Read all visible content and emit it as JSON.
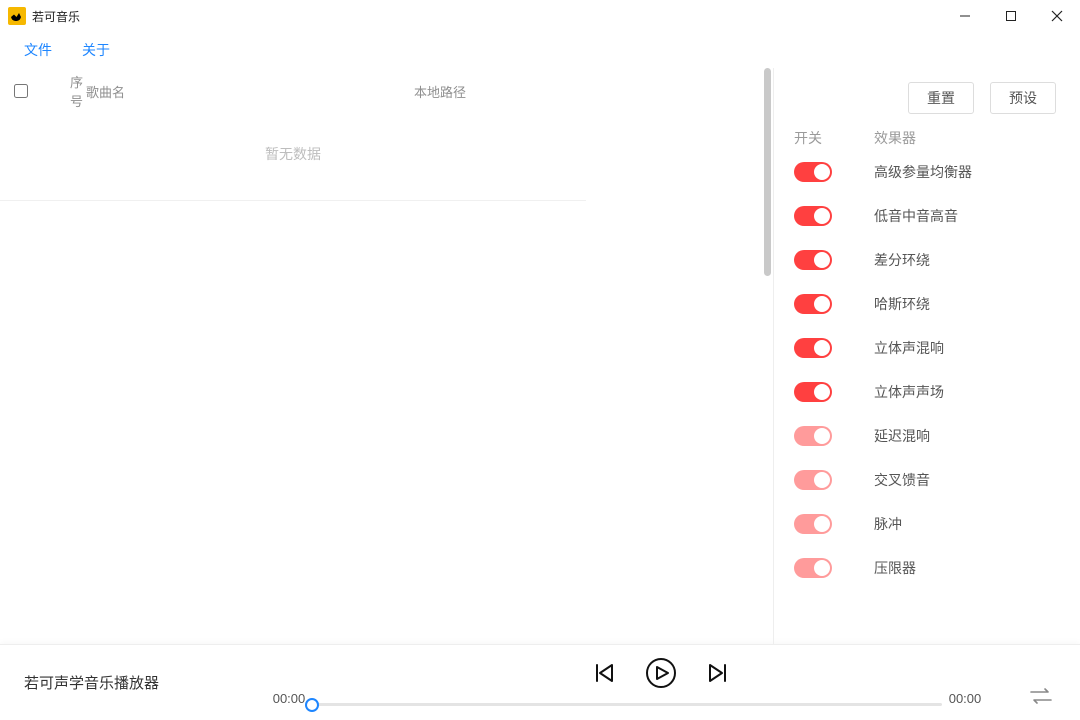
{
  "titlebar": {
    "title": "若可音乐"
  },
  "menu": {
    "file": "文件",
    "about": "关于"
  },
  "table": {
    "headers": {
      "seq": "序号",
      "name": "歌曲名",
      "path": "本地路径"
    },
    "empty": "暂无数据"
  },
  "right": {
    "reset_btn": "重置",
    "preset_btn": "预设",
    "header_switch": "开关",
    "header_fx": "效果器",
    "effects": [
      {
        "name": "高级参量均衡器",
        "state": "on-strong"
      },
      {
        "name": "低音中音高音",
        "state": "on-strong"
      },
      {
        "name": "差分环绕",
        "state": "on-strong"
      },
      {
        "name": "哈斯环绕",
        "state": "on-strong"
      },
      {
        "name": "立体声混响",
        "state": "on-strong"
      },
      {
        "name": "立体声声场",
        "state": "on-strong"
      },
      {
        "name": "延迟混响",
        "state": "on-weak"
      },
      {
        "name": "交叉馈音",
        "state": "on-weak"
      },
      {
        "name": "脉冲",
        "state": "on-weak"
      },
      {
        "name": "压限器",
        "state": "on-weak"
      }
    ]
  },
  "player": {
    "title": "若可声学音乐播放器",
    "time_left": "00:00",
    "time_right": "00:00"
  }
}
